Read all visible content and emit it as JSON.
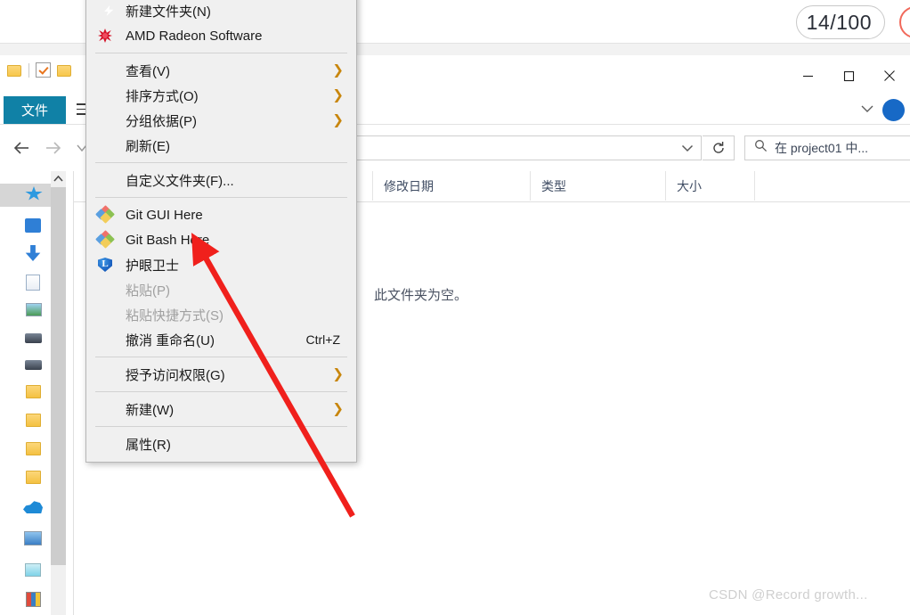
{
  "background_app": {
    "counter_label": "14/100",
    "circle_icon": "record-circle-icon"
  },
  "explorer": {
    "quick_access": {
      "folder_icon_1": "folder-icon",
      "separator": "toolbar-separator",
      "properties_icon": "properties-checkbox-icon",
      "folder_icon_2": "new-folder-icon"
    },
    "window_controls": {
      "minimize": "minimize-icon",
      "maximize": "maximize-icon",
      "close": "close-icon"
    },
    "ribbon": {
      "file_tab_label": "文件",
      "menu_icon": "hamburger-icon",
      "expand_icon": "chevron-down-icon",
      "help_icon": "help-icon"
    },
    "navigation": {
      "back_icon": "back-arrow-icon",
      "forward_icon": "forward-arrow-icon",
      "recent_icon": "recent-locations-icon",
      "up_icon": "up-arrow-icon"
    },
    "address_bar": {
      "value": "",
      "dropdown_icon": "chevron-down-icon",
      "refresh_icon": "refresh-icon"
    },
    "search": {
      "placeholder": "在 project01 中...",
      "icon": "search-icon"
    },
    "columns": [
      {
        "label": "修改日期"
      },
      {
        "label": "类型"
      },
      {
        "label": "大小"
      }
    ],
    "file_list": {
      "empty_message": "此文件夹为空。"
    },
    "nav_pane": {
      "scroll_up_icon": "scroll-up-icon",
      "items": [
        {
          "icon": "quick-access-star-icon"
        },
        {
          "icon": "desktop-icon"
        },
        {
          "icon": "downloads-icon"
        },
        {
          "icon": "documents-icon"
        },
        {
          "icon": "pictures-icon"
        },
        {
          "icon": "drive-icon"
        },
        {
          "icon": "drive-icon"
        },
        {
          "icon": "folder-icon"
        },
        {
          "icon": "folder-icon"
        },
        {
          "icon": "folder-icon"
        },
        {
          "icon": "folder-icon"
        },
        {
          "icon": "onedrive-icon"
        },
        {
          "icon": "this-pc-icon"
        },
        {
          "icon": "network-icon"
        },
        {
          "icon": "control-panel-icon"
        }
      ]
    }
  },
  "context_menu": {
    "items": [
      {
        "label": "新建文件夹(N)",
        "icon": "new-folder-bolt-icon",
        "type": "item"
      },
      {
        "label": "AMD Radeon Software",
        "icon": "amd-radeon-icon",
        "type": "item"
      },
      {
        "type": "separator"
      },
      {
        "label": "查看(V)",
        "icon": null,
        "type": "submenu"
      },
      {
        "label": "排序方式(O)",
        "icon": null,
        "type": "submenu"
      },
      {
        "label": "分组依据(P)",
        "icon": null,
        "type": "submenu"
      },
      {
        "label": "刷新(E)",
        "icon": null,
        "type": "item"
      },
      {
        "type": "separator"
      },
      {
        "label": "自定义文件夹(F)...",
        "icon": null,
        "type": "item"
      },
      {
        "type": "separator"
      },
      {
        "label": "Git GUI Here",
        "icon": "git-icon",
        "type": "item"
      },
      {
        "label": "Git Bash Here",
        "icon": "git-icon",
        "type": "item"
      },
      {
        "label": "护眼卫士",
        "icon": "eye-guard-shield-icon",
        "type": "item"
      },
      {
        "label": "粘贴(P)",
        "icon": null,
        "type": "item",
        "disabled": true
      },
      {
        "label": "粘贴快捷方式(S)",
        "icon": null,
        "type": "item",
        "disabled": true
      },
      {
        "label": "撤消 重命名(U)",
        "icon": null,
        "type": "item",
        "accel": "Ctrl+Z"
      },
      {
        "type": "separator"
      },
      {
        "label": "授予访问权限(G)",
        "icon": null,
        "type": "submenu"
      },
      {
        "type": "separator"
      },
      {
        "label": "新建(W)",
        "icon": null,
        "type": "submenu"
      },
      {
        "type": "separator"
      },
      {
        "label": "属性(R)",
        "icon": null,
        "type": "item"
      }
    ]
  },
  "annotation": {
    "arrow_color": "#f0201c",
    "target_label": "Git Bash Here"
  },
  "watermark": {
    "text": "CSDN @Record growth..."
  },
  "colors": {
    "file_tab": "#1081a6",
    "menu_background": "#f0f0f0",
    "submenu_arrow": "#c8860d",
    "annotation_red": "#f0201c"
  }
}
